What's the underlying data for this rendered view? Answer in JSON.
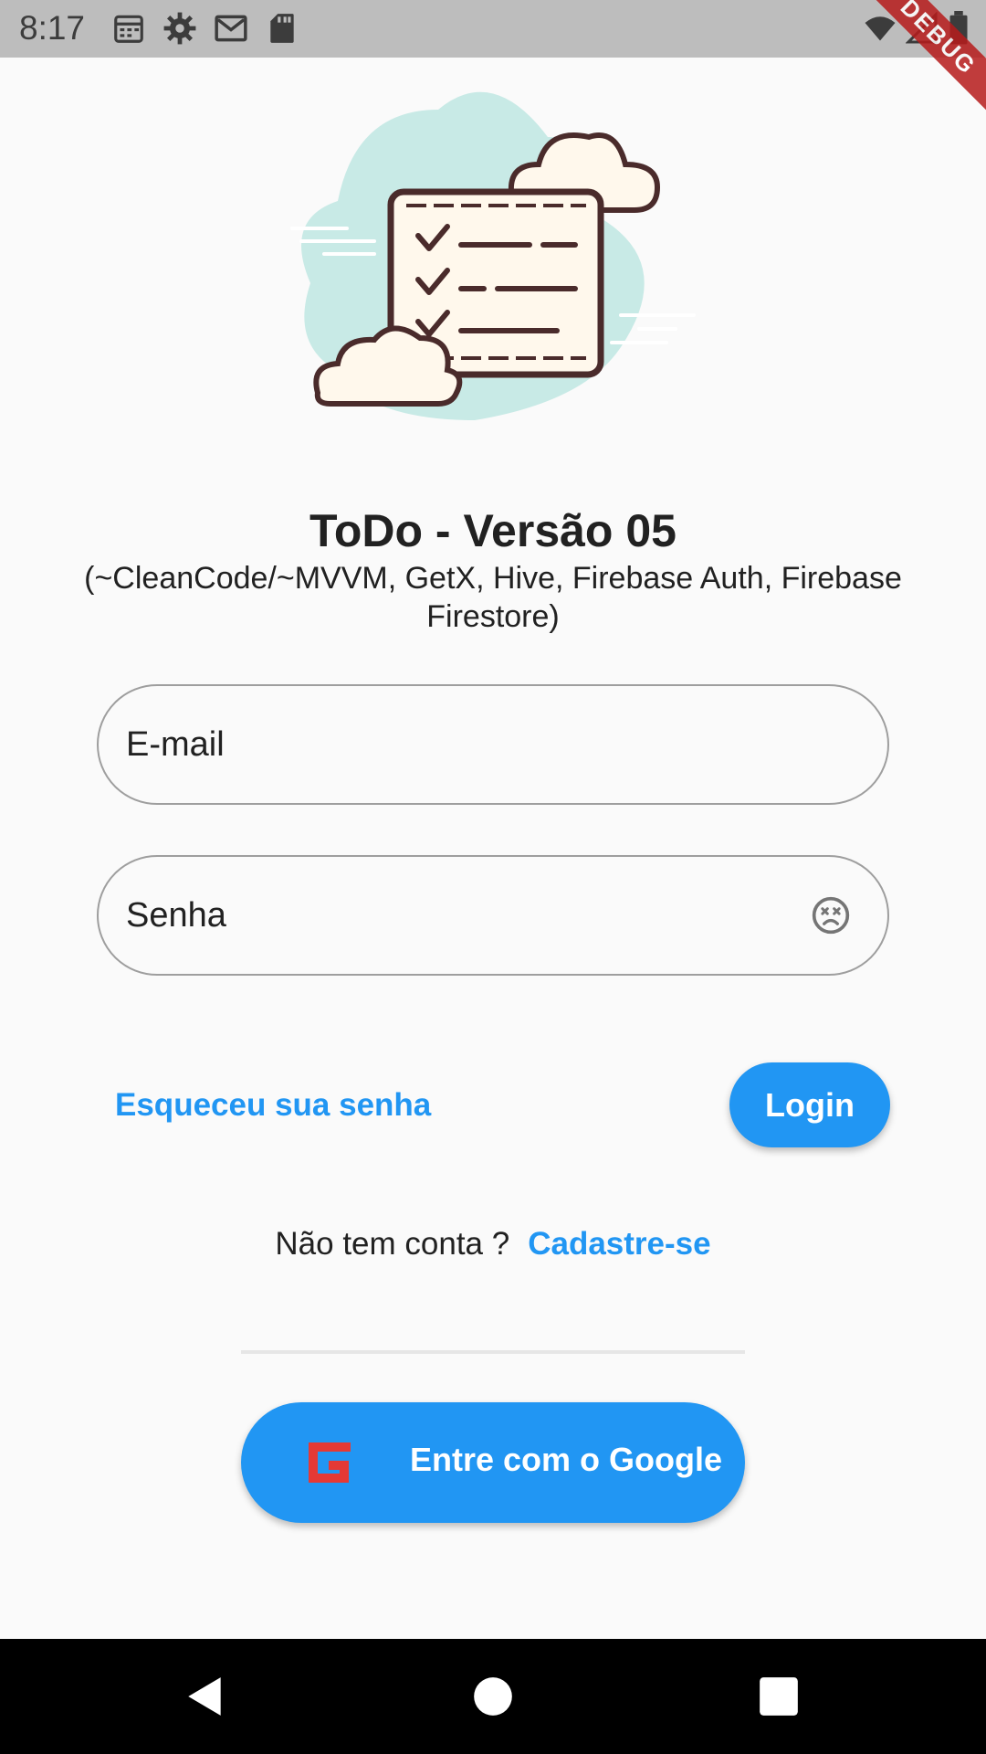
{
  "status_bar": {
    "time": "8:17",
    "icons": [
      "calendar-icon",
      "settings-icon",
      "gmail-icon",
      "sd-card-icon",
      "wifi-icon",
      "signal-icon",
      "battery-icon"
    ]
  },
  "debug_banner": "DEBUG",
  "app": {
    "title": "ToDo - Versão 05",
    "subtitle": "(~CleanCode/~MVVM, GetX, Hive, Firebase Auth, Firebase Firestore)"
  },
  "form": {
    "email_placeholder": "E-mail",
    "password_placeholder": "Senha"
  },
  "actions": {
    "forgot_password": "Esqueceu sua senha",
    "login": "Login",
    "signup_prompt": "Não tem conta ?",
    "signup_link": "Cadastre-se",
    "google_login": "Entre com o Google"
  },
  "colors": {
    "accent": "#2196f3",
    "google_icon": "#e53935",
    "background": "#fafafa"
  }
}
